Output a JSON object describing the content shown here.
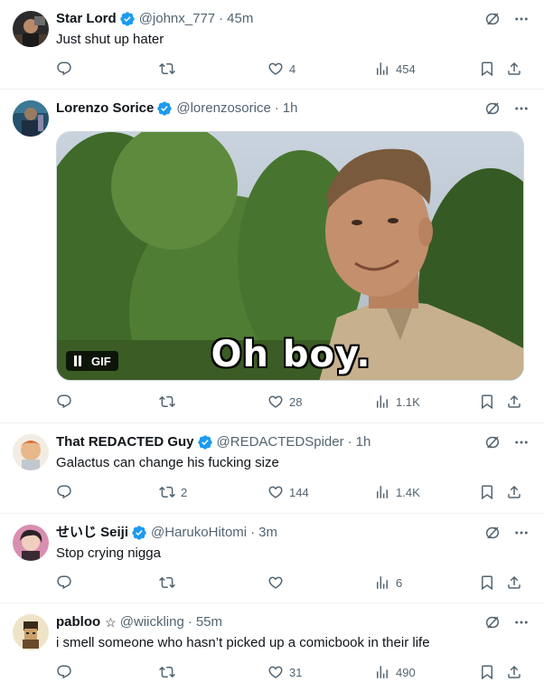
{
  "colors": {
    "accent": "#1d9bf0",
    "muted": "#536471",
    "text": "#0f1419",
    "divider": "#eff3f4"
  },
  "icons": {
    "reply": "reply-icon",
    "retweet": "retweet-icon",
    "like": "heart-icon",
    "views": "views-icon",
    "bookmark": "bookmark-icon",
    "share": "share-icon",
    "grok": "grok-icon",
    "more": "more-icon",
    "verified": "verified-badge-icon"
  },
  "tweets": [
    {
      "name": "Star Lord",
      "handle": "@johnx_777",
      "sep": "·",
      "time": "45m",
      "text": "Just shut up hater",
      "replies": "",
      "retweets": "",
      "likes": "4",
      "views": "454"
    },
    {
      "name": "Lorenzo Sorice",
      "handle": "@lorenzosorice",
      "sep": "·",
      "time": "1h",
      "text": "",
      "media": {
        "caption": "Oh boy.",
        "badge": "GIF"
      },
      "replies": "",
      "retweets": "",
      "likes": "28",
      "views": "1.1K"
    },
    {
      "name": "That REDACTED Guy",
      "handle": "@REDACTEDSpider",
      "sep": "·",
      "time": "1h",
      "text": "Galactus can change his fucking size",
      "replies": "",
      "retweets": "2",
      "likes": "144",
      "views": "1.4K"
    },
    {
      "name": "せいじ Seiji",
      "handle": "@HarukoHitomi",
      "sep": "·",
      "time": "3m",
      "text": "Stop crying nigga",
      "replies": "",
      "retweets": "",
      "likes": "",
      "views": "6"
    },
    {
      "name": "pabloo",
      "name_suffix": "☆",
      "handle": "@wiickling",
      "sep": "·",
      "time": "55m",
      "text": "i smell someone who hasn’t picked up a comicbook in their life",
      "replies": "",
      "retweets": "",
      "likes": "31",
      "views": "490"
    }
  ]
}
